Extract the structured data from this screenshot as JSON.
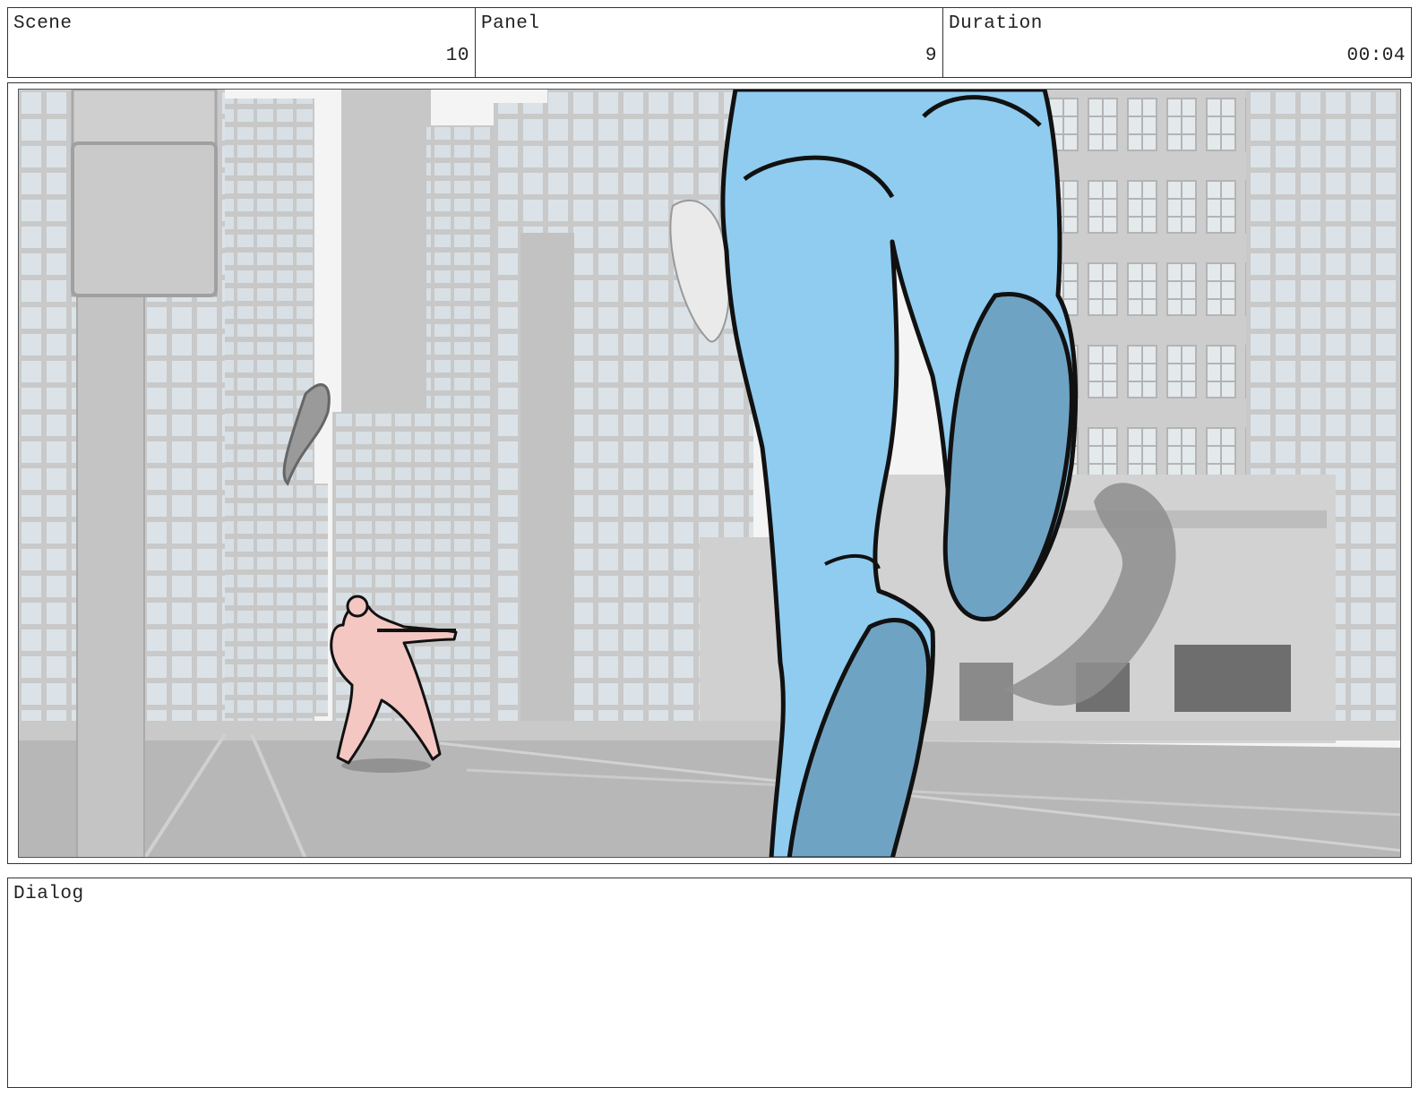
{
  "header": {
    "scene": {
      "label": "Scene",
      "value": "10"
    },
    "panel": {
      "label": "Panel",
      "value": "9"
    },
    "duration": {
      "label": "Duration",
      "value": "00:04"
    }
  },
  "panel_image": {
    "description_icon": "storyboard-sketch",
    "colors": {
      "sky": "#f4f4f4",
      "buildings": "#cfcfcf",
      "windows": "#dde5ea",
      "street": "#b5b5b5",
      "giant_legs": "#8fccf0",
      "giant_soles": "#6fa3c4",
      "soldier": "#f4c7c3",
      "ink": "#111111"
    }
  },
  "dialog": {
    "label": "Dialog",
    "text": ""
  }
}
